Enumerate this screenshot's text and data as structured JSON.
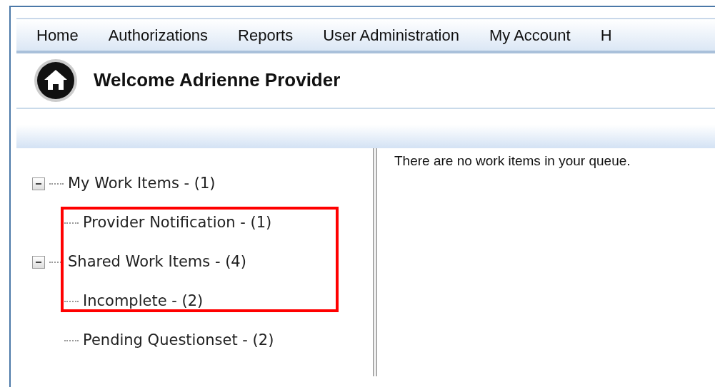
{
  "nav": {
    "items": [
      {
        "label": "Home"
      },
      {
        "label": "Authorizations"
      },
      {
        "label": "Reports"
      },
      {
        "label": "User Administration"
      },
      {
        "label": "My Account"
      },
      {
        "label": "H"
      }
    ]
  },
  "header": {
    "title": "Welcome Adrienne Provider"
  },
  "tree": [
    {
      "label": "My Work Items - (1)",
      "expanded": true,
      "children": [
        {
          "label": "Provider Notification - (1)"
        }
      ]
    },
    {
      "label": "Shared Work Items - (4)",
      "expanded": true,
      "children": [
        {
          "label": "Incomplete - (2)"
        },
        {
          "label": "Pending Questionset - (2)"
        }
      ]
    }
  ],
  "content": {
    "message": "There are no work items in your queue."
  },
  "annotation": {
    "kind": "rectangle",
    "color": "#ff0000"
  }
}
